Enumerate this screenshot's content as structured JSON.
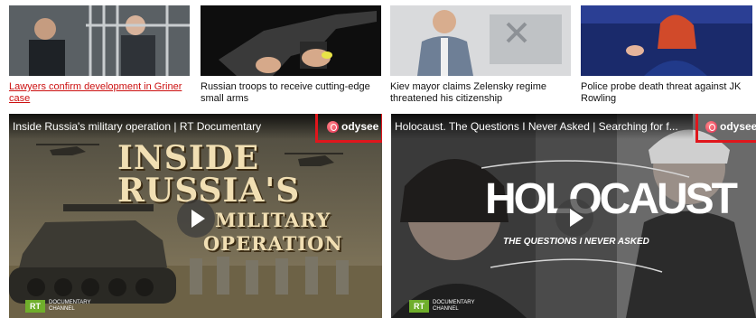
{
  "news": [
    {
      "caption": "Lawyers confirm development in Griner case",
      "is_link": true
    },
    {
      "caption": "Russian troops to receive cutting-edge small arms",
      "is_link": false
    },
    {
      "caption": "Kiev mayor claims Zelensky regime threatened his citizenship",
      "is_link": false
    },
    {
      "caption": "Police probe death threat against JK Rowling",
      "is_link": false
    }
  ],
  "videos": [
    {
      "title": "Inside Russia's military operation | RT Documentary",
      "brand": "odysee",
      "title_lines": [
        "INSIDE",
        "RUSSIA'S",
        "MILITARY",
        "OPERATION"
      ],
      "channel_logo": "RT",
      "channel_text": "DOCUMENTARY CHANNEL"
    },
    {
      "title": "Holocaust. The Questions I Never Asked | Searching for f...",
      "brand": "odysee",
      "title_lines": [
        "HOLOCAUST",
        "THE QUESTIONS I NEVER ASKED"
      ],
      "channel_logo": "RT",
      "channel_text": "DOCUMENTARY CHANNEL"
    }
  ],
  "colors": {
    "highlight": "#e0161c",
    "link": "#cc1111",
    "rt_green": "#6fae2b"
  }
}
